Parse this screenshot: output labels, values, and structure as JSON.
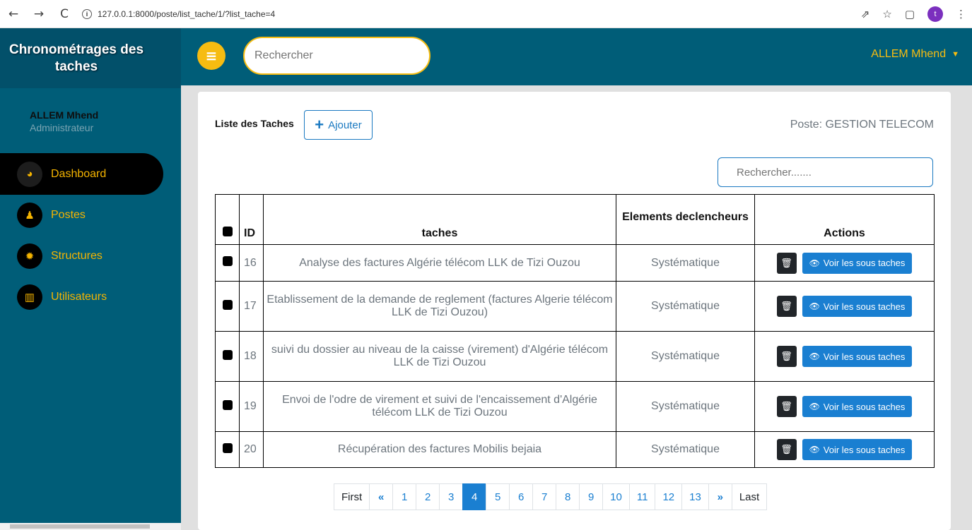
{
  "browser": {
    "url": "127.0.0.1:8000/poste/list_tache/1/?list_tache=4",
    "profile_initial": "t"
  },
  "sidebar": {
    "brand": "Chronométrages des taches",
    "user_name": "ALLEM Mhend",
    "user_role": "Administrateur",
    "items": [
      {
        "label": "Dashboard",
        "icon": "dashboard-icon"
      },
      {
        "label": "Postes",
        "icon": "user-edit-icon"
      },
      {
        "label": "Structures",
        "icon": "gear-icon"
      },
      {
        "label": "Utilisateurs",
        "icon": "chart-bar-icon"
      }
    ]
  },
  "topbar": {
    "search_placeholder": "Rechercher",
    "user": "ALLEM Mhend"
  },
  "page": {
    "title": "Liste des Taches",
    "add_label": "Ajouter",
    "poste": "Poste: GESTION TELECOM",
    "table_search_placeholder": "Rechercher......."
  },
  "table": {
    "headers": {
      "id": "ID",
      "tache": "taches",
      "elements": "Elements declencheurs",
      "actions": "Actions"
    },
    "rows": [
      {
        "id": "16",
        "tache": "Analyse des factures Algérie télécom LLK de Tizi Ouzou",
        "element": "Systématique",
        "voir": "Voir les sous taches"
      },
      {
        "id": "17",
        "tache": "Etablissement de la demande de reglement (factures Algerie télécom LLK de Tizi Ouzou)",
        "element": "Systématique",
        "voir": "Voir les sous taches"
      },
      {
        "id": "18",
        "tache": "suivi du dossier au niveau de la caisse (virement) d'Algérie télécom LLK de Tizi Ouzou",
        "element": "Systématique",
        "voir": "Voir les sous taches"
      },
      {
        "id": "19",
        "tache": "Envoi de l'odre de virement et suivi de l'encaissement d'Algérie télécom LLK de Tizi Ouzou",
        "element": "Systématique",
        "voir": "Voir les sous taches"
      },
      {
        "id": "20",
        "tache": "Récupération des factures Mobilis bejaia",
        "element": "Systématique",
        "voir": "Voir les sous taches"
      }
    ]
  },
  "pagination": {
    "first": "First",
    "prev": "«",
    "pages": [
      "1",
      "2",
      "3",
      "4",
      "5",
      "6",
      "7",
      "8",
      "9",
      "10",
      "11",
      "12",
      "13"
    ],
    "current": "4",
    "next": "»",
    "last": "Last"
  }
}
